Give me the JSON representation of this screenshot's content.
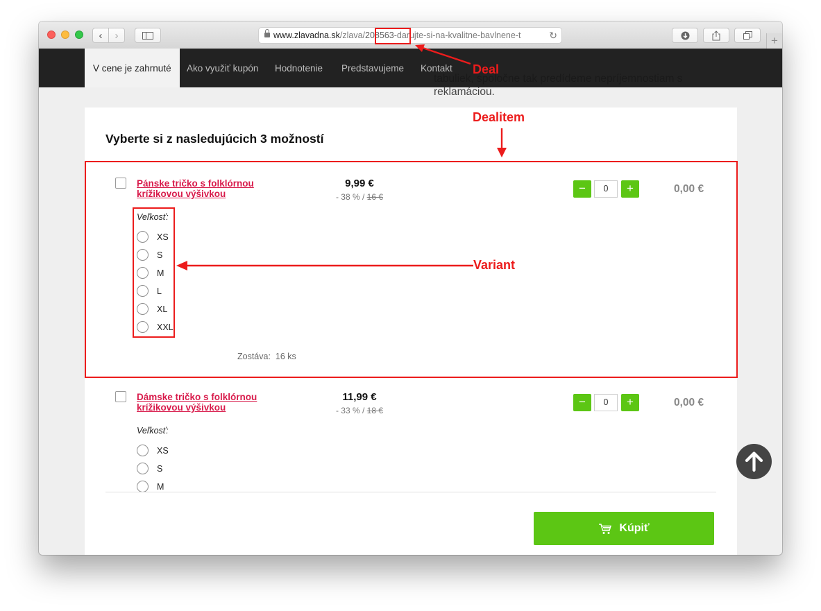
{
  "browser": {
    "url_host": "www.zlavadna.sk",
    "url_path_before": "/zlava/",
    "url_id": "208563",
    "url_path_after": "-darujte-si-na-kvalitne-bavlnene-t",
    "back_label": "‹",
    "forward_label": "›",
    "reload_label": "↻",
    "new_tab_label": "+"
  },
  "nav": {
    "tabs": [
      {
        "label": "V cene je zahrnuté"
      },
      {
        "label": "Ako využiť kupón"
      },
      {
        "label": "Hodnotenie"
      },
      {
        "label": "Predstavujeme"
      },
      {
        "label": "Kontakt"
      }
    ]
  },
  "overlay": {
    "line1": "tabuliek, spoločne tak predídeme nepríjemnostiam s",
    "line2": "reklamáciou."
  },
  "main": {
    "heading": "Vyberte si z nasledujúcich 3 možností",
    "variant_label": "Veľkosť:",
    "stock_label": "Zostáva:",
    "products": [
      {
        "name_line1": "Pánske tričko s folklórnou",
        "name_line2": "krížikovou výšivkou",
        "price": "9,99 €",
        "discount": "- 38 % /",
        "original_price": "16 €",
        "quantity": "0",
        "total": "0,00 €",
        "sizes": [
          "XS",
          "S",
          "M",
          "L",
          "XL",
          "XXL"
        ],
        "stock": "16 ks"
      },
      {
        "name_line1": "Dámske tričko s folklórnou",
        "name_line2": "krížikovou výšivkou",
        "price": "11,99 €",
        "discount": "- 33 % /",
        "original_price": "18 €",
        "quantity": "0",
        "total": "0,00 €",
        "sizes": [
          "XS",
          "S",
          "M"
        ]
      }
    ],
    "minus_label": "−",
    "plus_label": "+",
    "buy_label": "Kúpiť"
  },
  "annotations": {
    "deal": "Deal",
    "dealitem": "Dealitem",
    "variant": "Variant"
  },
  "colors": {
    "accent_green": "#5cc614",
    "product_link": "#d81b4b",
    "annotation_red": "#ec1c1c",
    "nav_bg": "#222222"
  }
}
